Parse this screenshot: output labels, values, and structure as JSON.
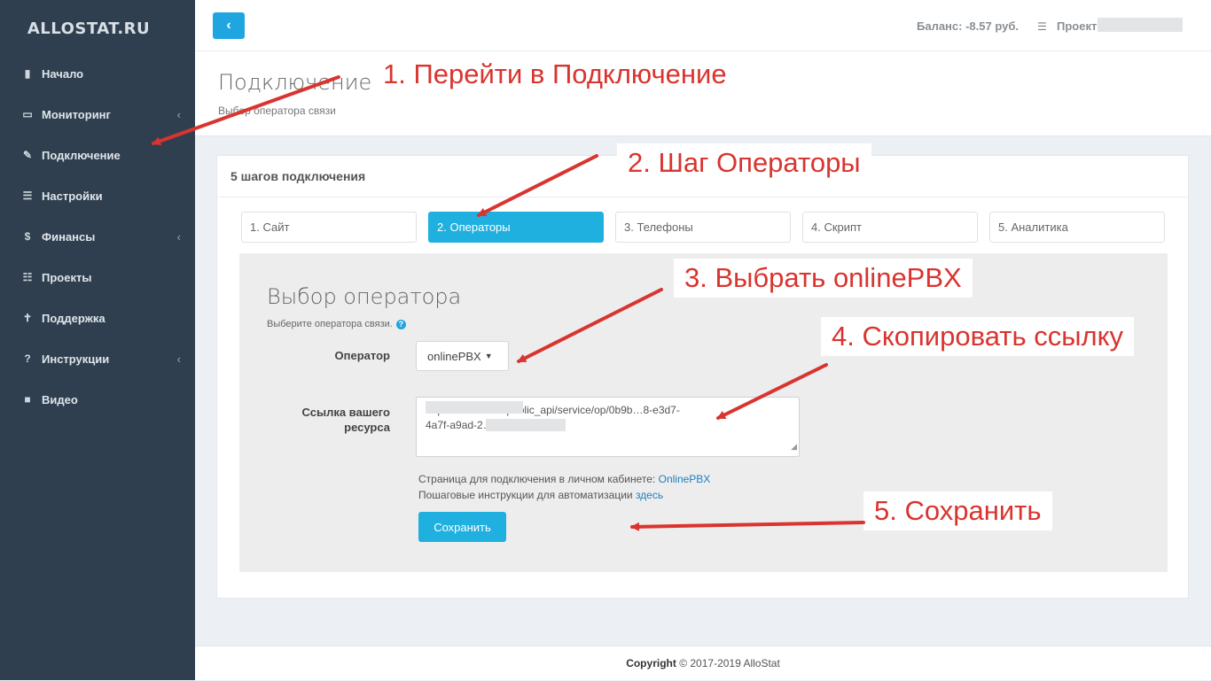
{
  "sidebar": {
    "logo": "ALLOSTAT.RU",
    "items": [
      {
        "label": "Начало",
        "icon": "bookmark-icon",
        "glyph": "▮"
      },
      {
        "label": "Мониторинг",
        "icon": "monitor-icon",
        "glyph": "▭"
      },
      {
        "label": "Подключение",
        "icon": "plug-icon",
        "glyph": "✎"
      },
      {
        "label": "Настройки",
        "icon": "sliders-icon",
        "glyph": "☰"
      },
      {
        "label": "Финансы",
        "icon": "dollar-icon",
        "glyph": "$"
      },
      {
        "label": "Проекты",
        "icon": "list-icon",
        "glyph": "☷"
      },
      {
        "label": "Поддержка",
        "icon": "support-icon",
        "glyph": "✝"
      },
      {
        "label": "Инструкции",
        "icon": "question-icon",
        "glyph": "?"
      },
      {
        "label": "Видео",
        "icon": "video-icon",
        "glyph": "■"
      }
    ]
  },
  "topbar": {
    "back_glyph": "‹",
    "balance": "Баланс: -8.57 руб.",
    "project_label": "Проект"
  },
  "page": {
    "title": "Подключение",
    "subtitle": "Выбор оператора связи"
  },
  "card": {
    "title": "5 шагов подключения",
    "steps": [
      "1. Сайт",
      "2. Операторы",
      "3. Телефоны",
      "4. Скрипт",
      "5. Аналитика"
    ],
    "active_step": 1
  },
  "panel": {
    "title": "Выбор оператора",
    "subtitle": "Выберите оператора связи.",
    "operator_label": "Оператор",
    "operator_value": "onlinePBX",
    "url_label_line1": "Ссылка вашего",
    "url_label_line2": "ресурса",
    "url_line1": "https://allostat.ru/public_api/service/op/0b9b…8-e3d7-",
    "url_line2": "4a7f-a9ad-2…6",
    "info1_text": "Страница для подключения в личном кабинете:",
    "info1_link": "OnlinePBX",
    "info2_text": "Пошаговые инструкции для автоматизации",
    "info2_link": "здесь",
    "save_label": "Сохранить"
  },
  "footer": {
    "bold": "Copyright",
    "text": "© 2017-2019 AlloStat"
  },
  "annotations": [
    "1. Перейти в Подключение",
    "2. Шаг Операторы",
    "3. Выбрать onlinePBX",
    "4. Скопировать ссылку",
    "5. Сохранить"
  ],
  "colors": {
    "sidebar_bg": "#2f3f4f",
    "accent": "#1fb0e0",
    "annotation_red": "#d9342f"
  }
}
